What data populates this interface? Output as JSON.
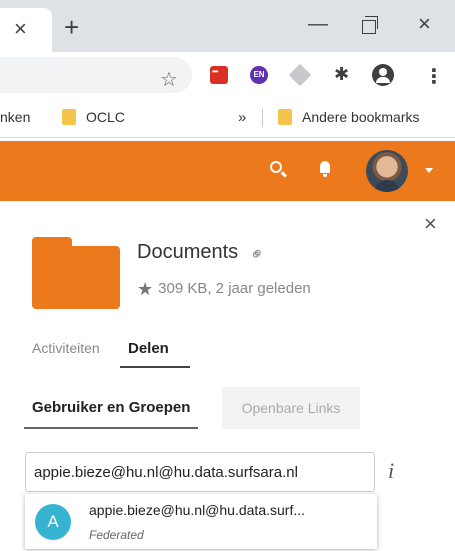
{
  "browser": {
    "tab_close_glyph": "×",
    "new_tab_glyph": "+",
    "window_minimize_glyph": "—",
    "window_close_glyph": "×",
    "extensions": [
      "star-icon",
      "red-extension-icon",
      "en-extension-icon",
      "grey-extension-icon",
      "puzzle-icon",
      "profile-icon",
      "menu-icon"
    ],
    "ext_en_label": "EN"
  },
  "bookmarks": {
    "item1": "nken",
    "item2": "OCLC",
    "overflow": "»",
    "other": "Andere bookmarks"
  },
  "colors": {
    "brand": "#ec7a1c",
    "avatar_suggestion": "#36b3d1"
  },
  "sidebar": {
    "close_glyph": "×",
    "file_name": "Documents",
    "file_meta": "309 KB, 2 jaar geleden",
    "tabs": {
      "activity": "Activiteiten",
      "share": "Delen"
    },
    "share_tabs": {
      "users_groups": "Gebruiker en Groepen",
      "public_links": "Openbare Links"
    },
    "share_input_value": "appie.bieze@hu.nl@hu.data.surfsara.nl",
    "info_glyph": "i",
    "suggestion": {
      "avatar_letter": "A",
      "name": "appie.bieze@hu.nl@hu.data.surf...",
      "type": "Federated"
    }
  }
}
